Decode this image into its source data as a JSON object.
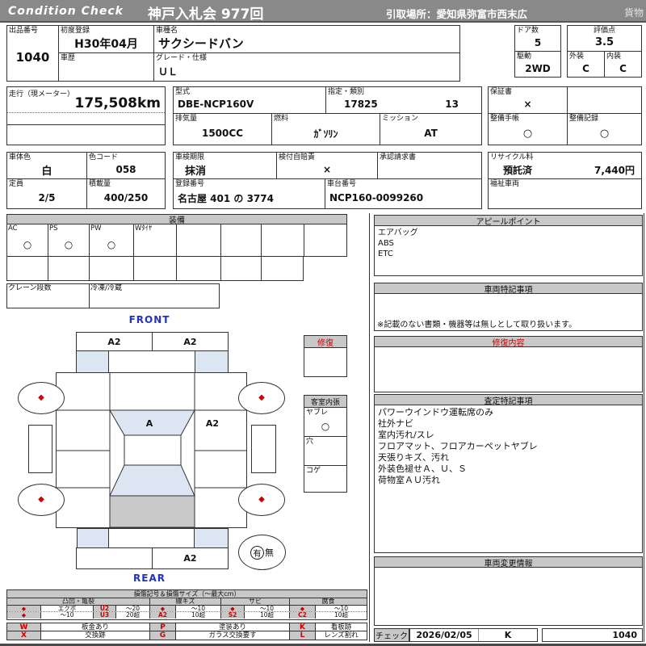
{
  "symbols": {
    "diamond": "◆"
  },
  "colors": {
    "top_bar": "#898989",
    "section_header": "#c8c8c8",
    "accent_red": "#cc0000",
    "label_blue": "#2233bb",
    "shade_blue": "#dce6f2",
    "shade_gray": "#c9c9c9"
  },
  "header": {
    "brand": "Condition  Check",
    "auction": "神戸入札会  977回",
    "pickup": "引取場所：愛知県弥富市西末広",
    "cargo": "貨物"
  },
  "row1": {
    "exhibit_label": "出品番号",
    "exhibit_value": "1040",
    "first_reg_label": "初度登録",
    "first_reg_value": "H30年04月",
    "model_label": "車種名",
    "model_value": "サクシードバン",
    "history_label": "車歴",
    "grade_label": "グレード・仕様",
    "grade_value": "ＵＬ",
    "doors_label": "ドア数",
    "doors_value": "5",
    "drive_label": "駆動",
    "drive_value": "2WD",
    "score_label": "評価点",
    "score_value": "3.5",
    "exterior_label": "外装",
    "exterior_value": "C",
    "interior_label": "内装",
    "interior_value": "C"
  },
  "row2": {
    "mileage_label": "走行（現メーター）",
    "mileage_value": "175,508km",
    "model_code_label": "型式",
    "model_code_value": "DBE-NCP160V",
    "designation_label": "指定・類別",
    "designation_value1": "17825",
    "designation_value2": "13",
    "displacement_label": "排気量",
    "displacement_value": "1500CC",
    "fuel_label": "燃料",
    "fuel_value": "ｶﾞｿﾘﾝ",
    "mission_label": "ミッション",
    "mission_value": "AT",
    "warranty_label": "保証書",
    "warranty_value": "×",
    "book_label": "整備手帳",
    "book_value": "○",
    "record_label": "整備記録",
    "record_value": "○"
  },
  "row3": {
    "color_label": "車体色",
    "color_value": "白",
    "color_code_label": "色コード",
    "color_code_value": "058",
    "capacity_label": "定員",
    "capacity_value": "2/5",
    "load_label": "積載量",
    "load_value": "400/250",
    "inspection_label": "車検期限",
    "inspection_value": "抹消",
    "insurance_label": "検付自賠責",
    "insurance_value": "×",
    "approval_label": "承認請求書",
    "reg_label": "登録番号",
    "reg_value": "名古屋  401 の  3774",
    "chassis_label": "車台番号",
    "chassis_value": "NCP160-0099260",
    "recycle_label": "リサイクル料",
    "recycle_status": "預託済",
    "recycle_fee": "7,440円",
    "welfare_label": "福祉車両"
  },
  "equipment": {
    "title": "装備",
    "cells": [
      {
        "label": "AC",
        "value": "○"
      },
      {
        "label": "PS",
        "value": "○"
      },
      {
        "label": "PW",
        "value": "○"
      },
      {
        "label": "Wﾀｲﾔ",
        "value": ""
      }
    ],
    "crane_label": "クレーン段数",
    "fridge_label": "冷凍/冷蔵"
  },
  "diagram": {
    "front_label": "FRONT",
    "rear_label": "REAR",
    "front_bumper_left": "A2",
    "front_bumper_right": "A2",
    "windshield_mark": "A",
    "right_panel_mark": "A2",
    "rear_bumper_mark": "A2",
    "has_label": "有",
    "none_label": "無",
    "repair_title": "修復",
    "cabin_title": "客室内張",
    "cabin_tear_label": "ヤブレ",
    "cabin_tear_value": "○",
    "cabin_hole_label": "穴",
    "cabin_burn_label": "コゲ"
  },
  "right": {
    "appeal_title": "アピールポイント",
    "appeal_lines": [
      "エアバッグ",
      "ABS",
      "ETC"
    ],
    "special_title": "車両特記事項",
    "special_note": "※記載のない書類・機器等は無しとして取り扱います。",
    "repair_title": "修復内容",
    "assessment_title": "査定特記事項",
    "assessment_lines": [
      "パワーウインドウ運転席のみ",
      "社外ナビ",
      "室内汚れ/スレ",
      "フロアマット、フロアカーペットヤブレ",
      "天張りキズ、汚れ",
      "外装色褪せＡ、Ｕ、Ｓ",
      "荷物室ＡＵ汚れ"
    ],
    "change_title": "車両変更情報",
    "check_label": "チェック",
    "check_date": "2026/02/05",
    "check_inspector": "K",
    "check_number": "1040"
  },
  "legend": {
    "title": "損傷記号＆損傷サイズ（～最大cm）",
    "group1": {
      "name": "凸凹・亀裂",
      "r1_desc": "エクボ",
      "r1_code": "U2",
      "r1_size": "～20",
      "r2_desc": "～10",
      "r2_code": "U3",
      "r2_size": "20超"
    },
    "group2": {
      "name": "線キズ",
      "r1_size": "～10",
      "r2_code": "A2",
      "r2_size": "10超"
    },
    "group3": {
      "name": "サビ",
      "r1_size": "～10",
      "r2_code": "S2",
      "r2_size": "10超"
    },
    "group4": {
      "name": "腐食",
      "r1_size": "～10",
      "r2_code": "C2",
      "r2_size": "10超"
    },
    "codes": {
      "w": "W",
      "w_desc": "板金あり",
      "p": "P",
      "p_desc": "塗装あり",
      "k": "K",
      "k_desc": "看板跡",
      "x": "X",
      "x_desc": "交換跡",
      "g": "G",
      "g_desc": "ガラス交換要す",
      "l": "L",
      "l_desc": "レンズ割れ"
    }
  }
}
